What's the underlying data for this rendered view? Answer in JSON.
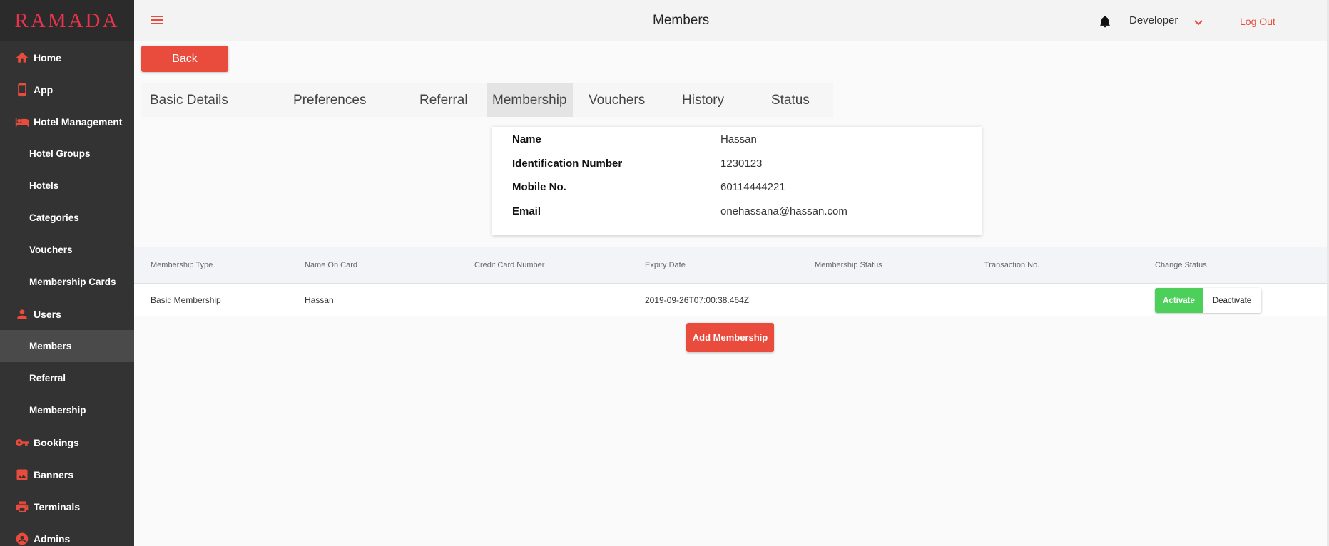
{
  "brand": {
    "logo_text": "RAMADA",
    "accent": "#e94b3c"
  },
  "sidebar": {
    "items": [
      {
        "label": "Home",
        "icon": "home-icon",
        "level": "top"
      },
      {
        "label": "App",
        "icon": "phone-icon",
        "level": "top"
      },
      {
        "label": "Hotel Management",
        "icon": "bed-icon",
        "level": "top"
      },
      {
        "label": "Hotel Groups",
        "level": "sub"
      },
      {
        "label": "Hotels",
        "level": "sub"
      },
      {
        "label": "Categories",
        "level": "sub"
      },
      {
        "label": "Vouchers",
        "level": "sub"
      },
      {
        "label": "Membership Cards",
        "level": "sub"
      },
      {
        "label": "Users",
        "icon": "person-icon",
        "level": "top"
      },
      {
        "label": "Members",
        "level": "sub",
        "active": true
      },
      {
        "label": "Referral",
        "level": "sub"
      },
      {
        "label": "Membership",
        "level": "sub"
      },
      {
        "label": "Bookings",
        "icon": "key-icon",
        "level": "top"
      },
      {
        "label": "Banners",
        "icon": "image-icon",
        "level": "top"
      },
      {
        "label": "Terminals",
        "icon": "printer-icon",
        "level": "top"
      },
      {
        "label": "Admins",
        "icon": "admin-icon",
        "level": "top"
      }
    ]
  },
  "header": {
    "title": "Members",
    "user": "Developer",
    "logout": "Log Out"
  },
  "back_label": "Back",
  "tabs": [
    {
      "label": "Basic Details"
    },
    {
      "label": "Preferences"
    },
    {
      "label": "Referral"
    },
    {
      "label": "Membership",
      "active": true
    },
    {
      "label": "Vouchers"
    },
    {
      "label": "History"
    },
    {
      "label": "Status"
    }
  ],
  "member": {
    "name_label": "Name",
    "name": "Hassan",
    "id_label": "Identification Number",
    "id": "1230123",
    "mobile_label": "Mobile No.",
    "mobile": "60114444221",
    "email_label": "Email",
    "email": "onehassana@hassan.com"
  },
  "table": {
    "headers": [
      "Membership Type",
      "Name On Card",
      "Credit Card Number",
      "Expiry Date",
      "Membership Status",
      "Transaction No.",
      "Change Status"
    ],
    "rows": [
      {
        "type": "Basic Membership",
        "name_on_card": "Hassan",
        "card_number": "",
        "expiry": "2019-09-26T07:00:38.464Z",
        "status": "",
        "transaction": "",
        "activate": "Activate",
        "deactivate": "Deactivate"
      }
    ]
  },
  "add_membership_label": "Add Membership"
}
